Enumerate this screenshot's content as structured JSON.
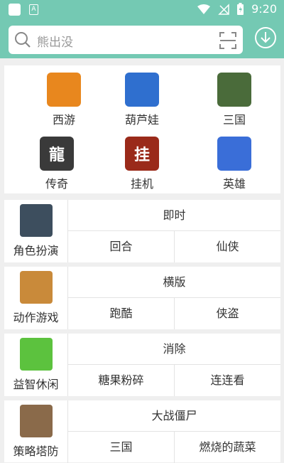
{
  "status": {
    "time": "9:20"
  },
  "search": {
    "placeholder": "熊出没"
  },
  "categories": [
    {
      "label": "西游",
      "icon": "xiyou-game-icon",
      "color": "#e8871e",
      "glyph": ""
    },
    {
      "label": "葫芦娃",
      "icon": "huluwa-game-icon",
      "color": "#2f6fcf",
      "glyph": ""
    },
    {
      "label": "三国",
      "icon": "sanguo-game-icon",
      "color": "#4a6b3a",
      "glyph": ""
    },
    {
      "label": "传奇",
      "icon": "chuanqi-game-icon",
      "color": "#3a3a3a",
      "glyph": "龍"
    },
    {
      "label": "挂机",
      "icon": "guaji-game-icon",
      "color": "#9a2a1a",
      "glyph": "挂"
    },
    {
      "label": "英雄",
      "icon": "yingxiong-game-icon",
      "color": "#3a6ed8",
      "glyph": ""
    }
  ],
  "rows": [
    {
      "label": "角色扮演",
      "icon": "role-play-icon",
      "color": "#3d4e5e",
      "top": "即时",
      "left": "回合",
      "right": "仙侠"
    },
    {
      "label": "动作游戏",
      "icon": "action-game-icon",
      "color": "#c98a3a",
      "top": "横版",
      "left": "跑酷",
      "right": "侠盗"
    },
    {
      "label": "益智休闲",
      "icon": "puzzle-casual-icon",
      "color": "#5cc23e",
      "top": "消除",
      "left": "糖果粉碎",
      "right": "连连看"
    },
    {
      "label": "策略塔防",
      "icon": "strategy-tower-icon",
      "color": "#8a6a4a",
      "top": "大战僵尸",
      "left": "三国",
      "right": "燃烧的蔬菜"
    }
  ]
}
